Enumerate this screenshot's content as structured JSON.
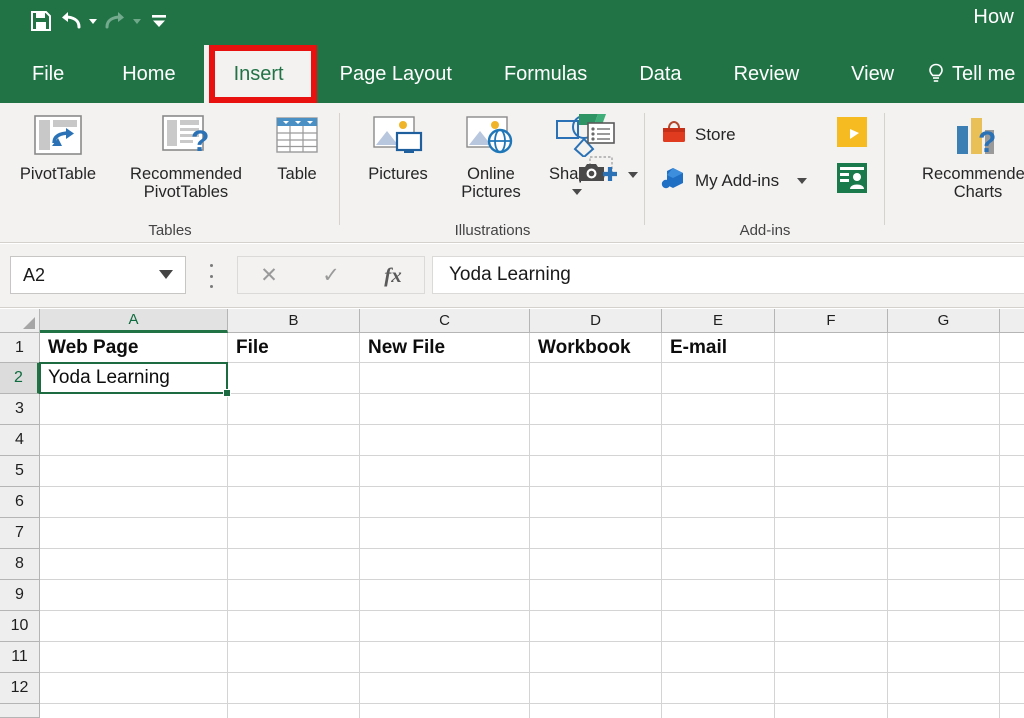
{
  "titlebar": {
    "right_text": "How",
    "quick_access": [
      {
        "name": "save-icon",
        "label": "Save"
      },
      {
        "name": "undo-icon",
        "label": "Undo"
      },
      {
        "name": "redo-icon",
        "label": "Redo"
      },
      {
        "name": "customize-quick-access-toolbar-icon",
        "label": "Customize Quick Access Toolbar"
      }
    ]
  },
  "ribbon": {
    "tabs": [
      {
        "label": "File",
        "active": false
      },
      {
        "label": "Home",
        "active": false
      },
      {
        "label": "Insert",
        "active": true
      },
      {
        "label": "Page Layout",
        "active": false
      },
      {
        "label": "Formulas",
        "active": false
      },
      {
        "label": "Data",
        "active": false
      },
      {
        "label": "Review",
        "active": false
      },
      {
        "label": "View",
        "active": false
      }
    ],
    "tell_me": "Tell me",
    "highlight_color": "#e8110f",
    "accent_color": "#217346",
    "groups": [
      {
        "name": "Tables",
        "label": "Tables",
        "buttons": [
          {
            "label": "PivotTable",
            "icon": "pivot-table-icon"
          },
          {
            "label": "Recommended\nPivotTables",
            "icon": "recommended-pivot-tables-icon"
          },
          {
            "label": "Table",
            "icon": "table-icon"
          }
        ]
      },
      {
        "name": "Illustrations",
        "label": "Illustrations",
        "buttons": [
          {
            "label": "Pictures",
            "icon": "pictures-icon"
          },
          {
            "label": "Online\nPictures",
            "icon": "online-pictures-icon"
          },
          {
            "label": "Shapes",
            "icon": "shapes-icon",
            "has_dropdown": true
          },
          {
            "label": "",
            "icon": "smartart-icon"
          },
          {
            "label": "",
            "icon": "screenshot-icon",
            "has_dropdown": true
          }
        ]
      },
      {
        "name": "Add-ins",
        "label": "Add-ins",
        "buttons": [
          {
            "label": "Store",
            "icon": "store-icon"
          },
          {
            "label": "My Add-ins",
            "icon": "my-add-ins-icon",
            "has_dropdown": true
          },
          {
            "label": "",
            "icon": "bing-maps-icon"
          },
          {
            "label": "",
            "icon": "people-graph-icon"
          }
        ]
      },
      {
        "name": "Charts",
        "label": "",
        "buttons": [
          {
            "label": "Recommended\nCharts",
            "icon": "recommended-charts-icon"
          }
        ]
      }
    ]
  },
  "formula_bar": {
    "name_box_value": "A2",
    "cancel_label": "✕",
    "enter_label": "✓",
    "function_label": "fx",
    "formula_value": "Yoda Learning"
  },
  "sheet": {
    "columns": [
      "A",
      "B",
      "C",
      "D",
      "E",
      "F",
      "G"
    ],
    "selected_column": "A",
    "rows": [
      "1",
      "2",
      "3",
      "4",
      "5",
      "6",
      "7",
      "8",
      "9",
      "10",
      "11",
      "12"
    ],
    "selected_row": "2",
    "selected_cell": "A2",
    "cells": [
      {
        "ref": "A1",
        "col": 0,
        "row": 0,
        "value": "Web Page",
        "bold": true
      },
      {
        "ref": "B1",
        "col": 1,
        "row": 0,
        "value": "File",
        "bold": true
      },
      {
        "ref": "C1",
        "col": 2,
        "row": 0,
        "value": "New File",
        "bold": true
      },
      {
        "ref": "D1",
        "col": 3,
        "row": 0,
        "value": "Workbook",
        "bold": true
      },
      {
        "ref": "E1",
        "col": 4,
        "row": 0,
        "value": "E-mail",
        "bold": true
      },
      {
        "ref": "A2",
        "col": 0,
        "row": 1,
        "value": "Yoda Learning",
        "bold": false
      }
    ]
  }
}
